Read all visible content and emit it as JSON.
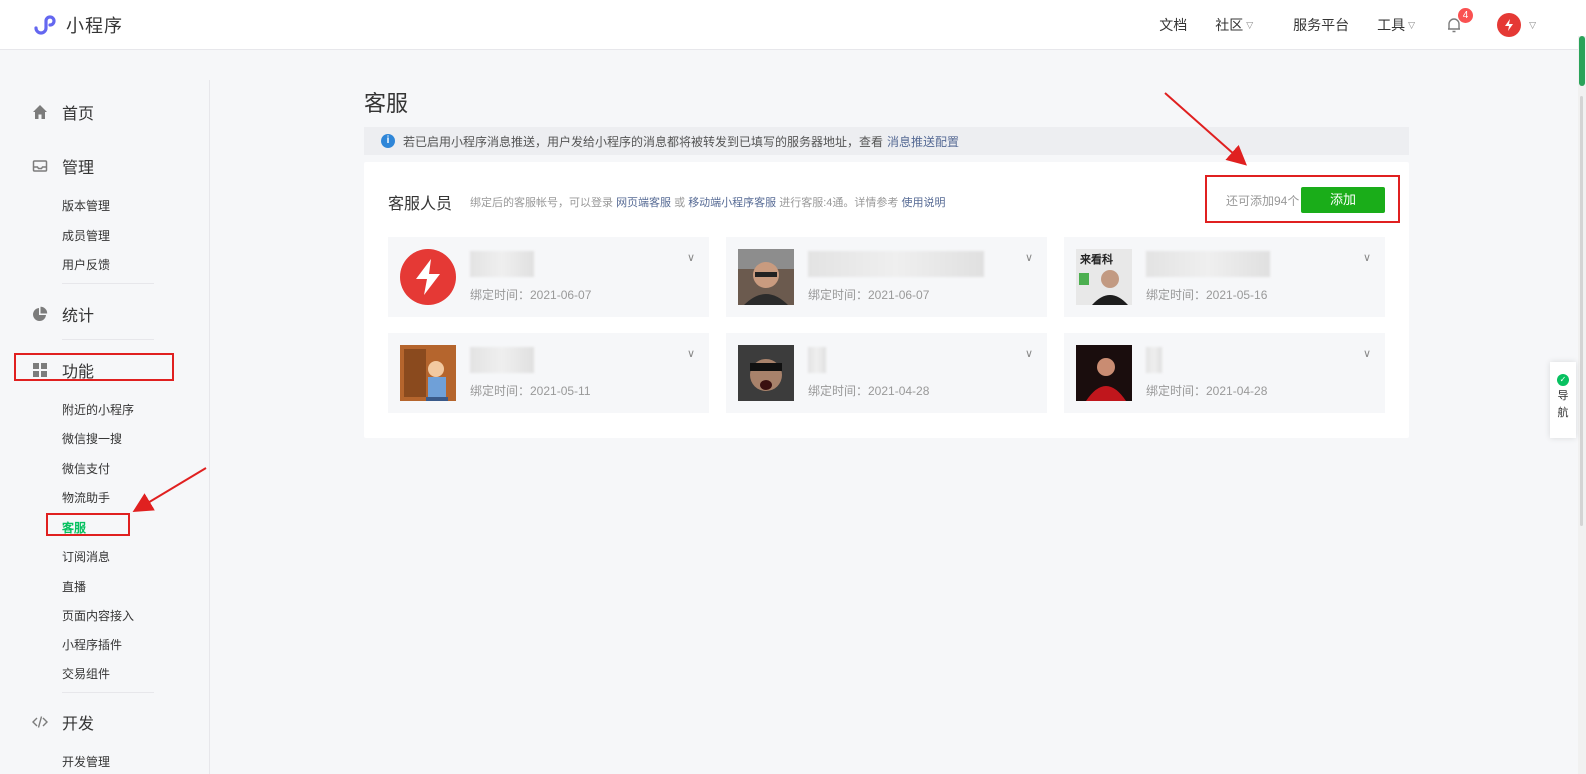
{
  "app": {
    "title": "小程序"
  },
  "topnav": {
    "docs": "文档",
    "community": "社区",
    "service_platform": "服务平台",
    "tools": "工具",
    "notification_count": "4"
  },
  "sidebar": {
    "home": "首页",
    "manage": "管理",
    "manage_items": [
      "版本管理",
      "成员管理",
      "用户反馈"
    ],
    "stats": "统计",
    "features": "功能",
    "feature_items": [
      "附近的小程序",
      "微信搜一搜",
      "微信支付",
      "物流助手",
      "客服",
      "订阅消息",
      "直播",
      "页面内容接入",
      "小程序插件",
      "交易组件"
    ],
    "develop": "开发",
    "develop_items": [
      "开发管理"
    ]
  },
  "main": {
    "title": "客服",
    "notice": {
      "text": "若已启用小程序消息推送，用户发给小程序的消息都将被转发到已填写的服务器地址，查看",
      "link": "消息推送配置"
    },
    "panel": {
      "title": "客服人员",
      "desc_prefix": "绑定后的客服帐号，可以登录",
      "link_web": "网页端客服",
      "or": "或",
      "link_mobile": "移动端小程序客服",
      "desc_middle": "进行客服:4通。详情参考",
      "link_guide": "使用说明",
      "remain": "还可添加94个",
      "add_button": "添加"
    },
    "agents": [
      {
        "bind_date": "绑定时间：2021-06-07",
        "avatar": "red-logo"
      },
      {
        "bind_date": "绑定时间：2021-06-07",
        "avatar": "photo-man-glasses"
      },
      {
        "bind_date": "绑定时间：2021-05-16",
        "avatar": "photo-man-poster"
      },
      {
        "bind_date": "绑定时间：2021-05-11",
        "avatar": "cartoon"
      },
      {
        "bind_date": "绑定时间：2021-04-28",
        "avatar": "photo-mask"
      },
      {
        "bind_date": "绑定时间：2021-04-28",
        "avatar": "photo-red"
      }
    ],
    "avatar_poster_text": "来看科"
  },
  "side_nav": {
    "label_1": "导",
    "label_2": "航"
  },
  "colors": {
    "accent_green": "#1aad19",
    "link_blue": "#576b95",
    "annotation_red": "#e02020"
  }
}
